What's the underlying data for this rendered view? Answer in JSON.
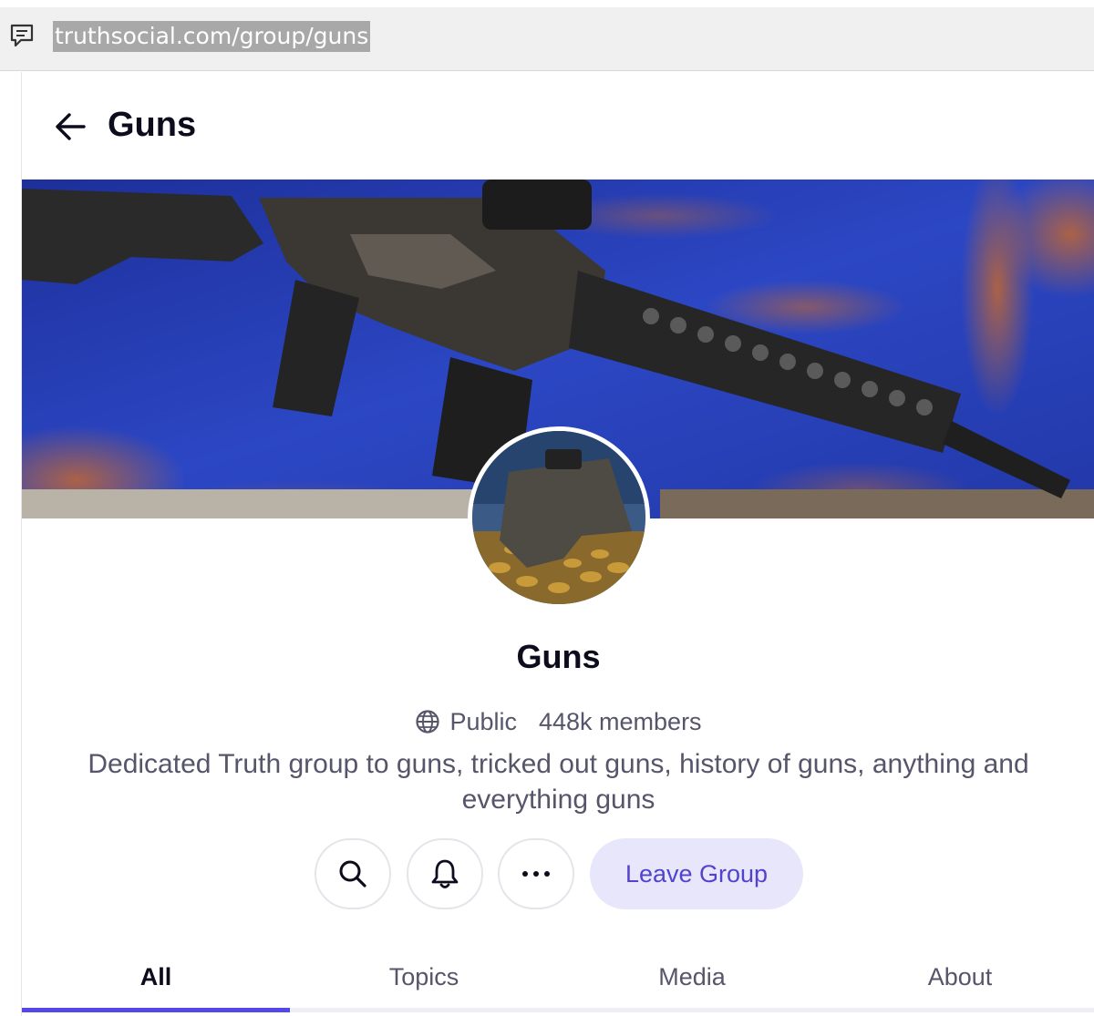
{
  "browser": {
    "url": "truthsocial.com/group/guns",
    "page_icon": "comment-page-icon"
  },
  "header": {
    "back_icon": "arrow-left-icon",
    "title": "Guns"
  },
  "group": {
    "cover_image": "rifle-on-blue-rust-background",
    "avatar_image": "pistol-with-ammo",
    "name": "Guns",
    "privacy_icon": "globe-icon",
    "privacy": "Public",
    "members": "448k members",
    "description": "Dedicated Truth group to guns, tricked out guns, history of guns, anything and everything guns"
  },
  "actions": {
    "search_icon": "search-icon",
    "notifications_icon": "bell-icon",
    "more_icon": "more-horizontal-icon",
    "leave_label": "Leave Group"
  },
  "tabs": [
    {
      "label": "All",
      "active": true
    },
    {
      "label": "Topics",
      "active": false
    },
    {
      "label": "Media",
      "active": false
    },
    {
      "label": "About",
      "active": false
    }
  ],
  "colors": {
    "accent": "#5448ea",
    "leave_bg": "#e8e6fb",
    "leave_text": "#5143ce",
    "title_text": "#0d0c1c",
    "muted_text": "#56556a"
  }
}
